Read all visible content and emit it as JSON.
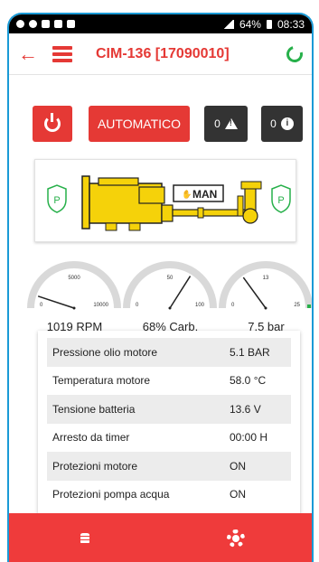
{
  "status_bar": {
    "battery": "64%",
    "time": "08:33"
  },
  "header": {
    "title": "CIM-136 [17090010]"
  },
  "controls": {
    "mode_label": "AUTOMATICO",
    "alarm_count": "0",
    "info_count": "0"
  },
  "engine": {
    "mode_badge": "MAN",
    "left_badge": "P",
    "right_badge": "P"
  },
  "gauges": [
    {
      "label": "1019 RPM",
      "min": "0",
      "mid": "5000",
      "max": "10000",
      "value": 1019,
      "range_max": 10000
    },
    {
      "label": "68% Carb.",
      "min": "0",
      "mid": "50",
      "max": "100",
      "value": 68,
      "range_max": 100
    },
    {
      "label": "7.5 bar",
      "min": "0",
      "mid": "13",
      "max": "25",
      "value": 7.5,
      "range_max": 25
    }
  ],
  "parameters": [
    {
      "name": "Pressione olio motore",
      "value": "5.1 BAR"
    },
    {
      "name": "Temperatura motore",
      "value": "58.0 °C"
    },
    {
      "name": "Tensione batteria",
      "value": "13.6 V"
    },
    {
      "name": "Arresto da timer",
      "value": "00:00 H"
    },
    {
      "name": "Protezioni motore",
      "value": "ON"
    },
    {
      "name": "Protezioni pompa acqua",
      "value": "ON"
    }
  ],
  "colors": {
    "accent": "#e53935",
    "bottom_bar": "#ef3b3b",
    "dark_button": "#333333",
    "ok_green": "#27b04a",
    "engine_yellow": "#f5d20a"
  }
}
